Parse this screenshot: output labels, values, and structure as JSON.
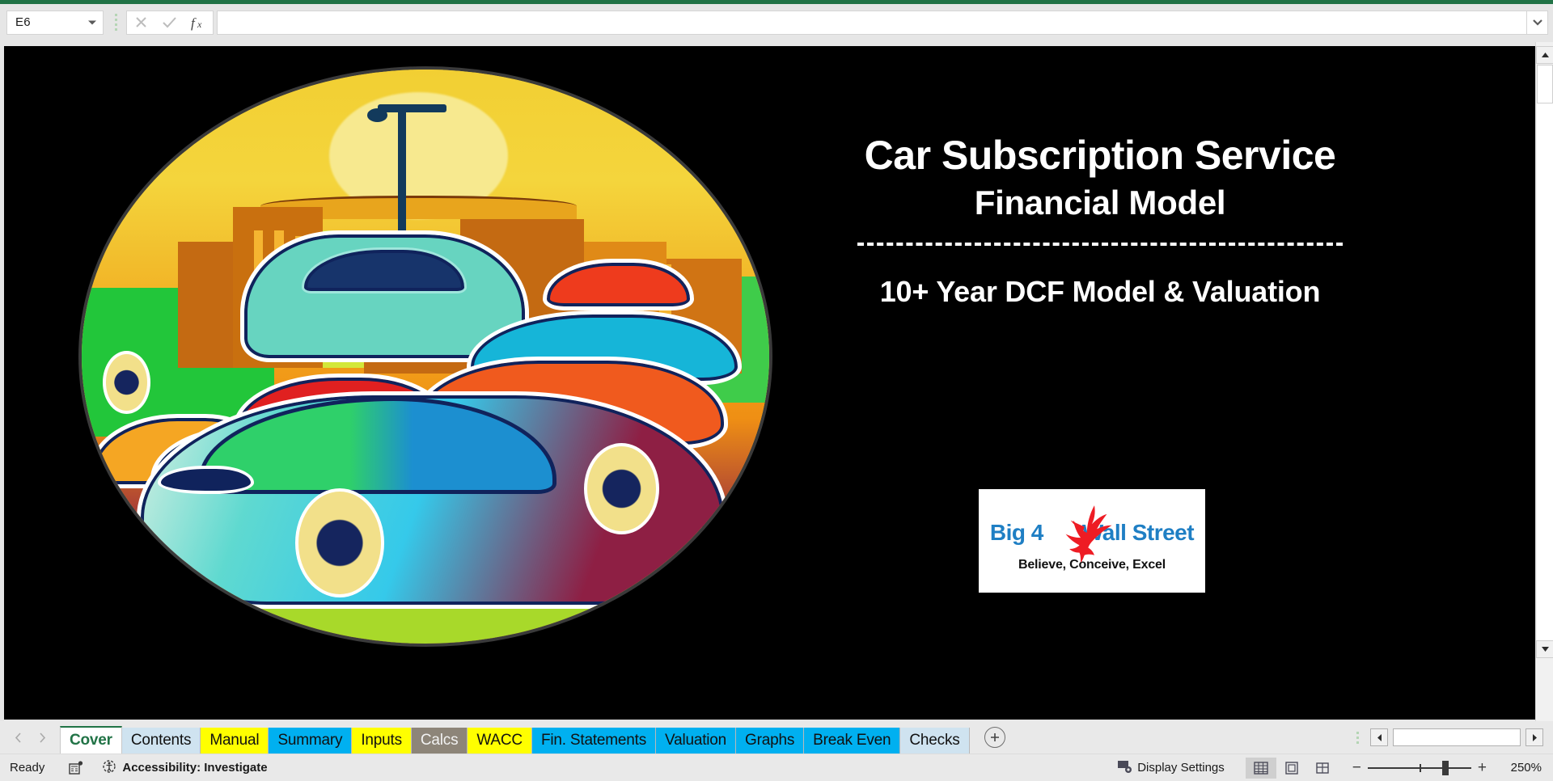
{
  "app": {
    "accent_green": "#217346"
  },
  "formula_bar": {
    "name_box_value": "E6",
    "name_box_caret_icon": "chevron-down-icon",
    "cancel_icon": "cancel-x-icon",
    "enter_icon": "enter-check-icon",
    "function_icon": "insert-function-fx-icon",
    "formula_value": "",
    "expand_icon": "expand-formula-bar-chevron-icon"
  },
  "cover": {
    "title": "Car Subscription Service",
    "subtitle": "Financial Model",
    "tagline": "10+ Year DCF Model & Valuation",
    "divider": "dashed-rule",
    "artwork_name": "colorful-cars-city-illustration"
  },
  "logo": {
    "word_left": "Big 4",
    "word_right": "Wall Street",
    "tagline": "Believe, Conceive, Excel",
    "bird_icon": "red-eagle-icon",
    "text_color": "#1f7fc4",
    "bird_color": "#ee1c24"
  },
  "sheet_tabs": {
    "prev_icon": "chevron-left-icon",
    "next_icon": "chevron-right-icon",
    "add_sheet_icon": "plus-circle-icon",
    "items": [
      {
        "label": "Cover",
        "style": "active"
      },
      {
        "label": "Contents",
        "style": "light"
      },
      {
        "label": "Manual",
        "style": "yellow"
      },
      {
        "label": "Summary",
        "style": "cyan"
      },
      {
        "label": "Inputs",
        "style": "yellow"
      },
      {
        "label": "Calcs",
        "style": "gray"
      },
      {
        "label": "WACC",
        "style": "yellow"
      },
      {
        "label": "Fin. Statements",
        "style": "cyan"
      },
      {
        "label": "Valuation",
        "style": "cyan"
      },
      {
        "label": "Graphs",
        "style": "cyan"
      },
      {
        "label": "Break Even",
        "style": "cyan"
      },
      {
        "label": "Checks",
        "style": "light"
      }
    ]
  },
  "scrollbars": {
    "v_up_icon": "scroll-up-arrow-icon",
    "v_down_icon": "scroll-down-arrow-icon",
    "h_left_icon": "scroll-left-arrow-icon",
    "h_right_icon": "scroll-right-arrow-icon"
  },
  "status_bar": {
    "state": "Ready",
    "macro_icon": "record-macro-icon",
    "accessibility_icon": "accessibility-icon",
    "accessibility_label": "Accessibility: Investigate",
    "display_settings_icon": "display-settings-icon",
    "display_settings_label": "Display Settings",
    "view_normal_icon": "normal-view-icon",
    "view_pagelayout_icon": "page-layout-view-icon",
    "view_pagebreak_icon": "page-break-preview-icon",
    "zoom_out_label": "−",
    "zoom_in_label": "+",
    "zoom_level": "250%"
  }
}
